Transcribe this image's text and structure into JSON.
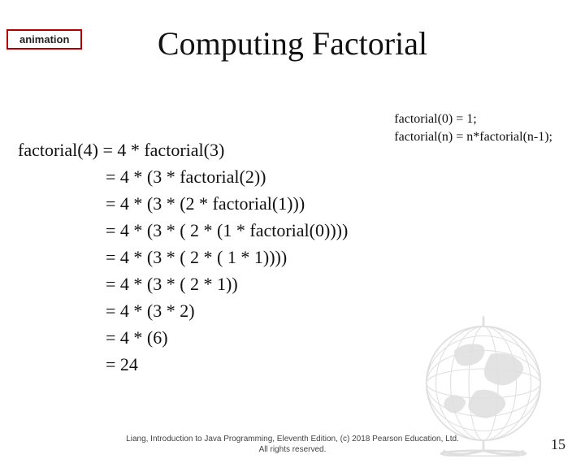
{
  "animation_label": "animation",
  "title": "Computing Factorial",
  "formula": {
    "base": "factorial(0) = 1;",
    "rule": "factorial(n) = n*factorial(n-1);"
  },
  "steps": {
    "lhs": "factorial(4)",
    "lines": [
      "= 4 * factorial(3)",
      "= 4 * (3 * factorial(2))",
      "= 4 * (3 * (2 * factorial(1)))",
      "= 4 * (3 * ( 2 * (1 * factorial(0))))",
      "= 4 * (3 * ( 2 * ( 1 * 1))))",
      "= 4 * (3 * ( 2 * 1))",
      "= 4 * (3 * 2)",
      "= 4 * (6)",
      "= 24"
    ]
  },
  "citation": {
    "line1": "Liang, Introduction to Java Programming, Eleventh Edition, (c) 2018 Pearson Education, Ltd.",
    "line2": "All rights reserved."
  },
  "page_number": "15"
}
